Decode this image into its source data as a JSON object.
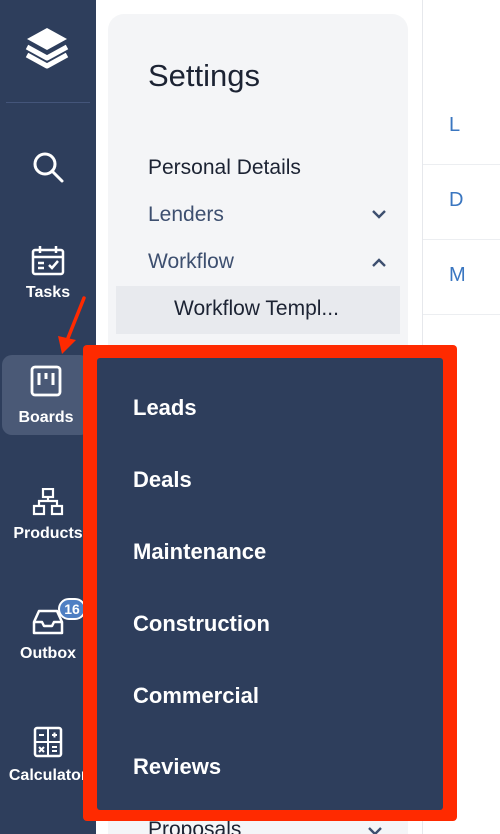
{
  "sidebar": {
    "items": [
      {
        "label": "Tasks"
      },
      {
        "label": "Boards"
      },
      {
        "label": "Products"
      },
      {
        "label": "Outbox",
        "badge": "16"
      },
      {
        "label": "Calculator"
      }
    ],
    "icons": [
      "logo-icon",
      "search-icon",
      "calendar-check-icon",
      "board-icon",
      "hierarchy-icon",
      "inbox-icon",
      "calculator-icon"
    ]
  },
  "settings": {
    "title": "Settings",
    "menu": [
      {
        "label": "Personal Details"
      },
      {
        "label": "Lenders",
        "chevron": "down"
      },
      {
        "label": "Workflow",
        "chevron": "up"
      }
    ],
    "sub_item": "Workflow Templ...",
    "cut_item": "Proposals"
  },
  "right_column": {
    "rows": [
      "L",
      "D",
      "M"
    ]
  },
  "dropdown": {
    "items": [
      "Leads",
      "Deals",
      "Maintenance",
      "Construction",
      "Commercial",
      "Reviews"
    ]
  },
  "colors": {
    "rail": "#2e3e5c",
    "highlight": "#ff2a00",
    "panel": "#f4f5f7",
    "accent": "#3a76c0"
  }
}
